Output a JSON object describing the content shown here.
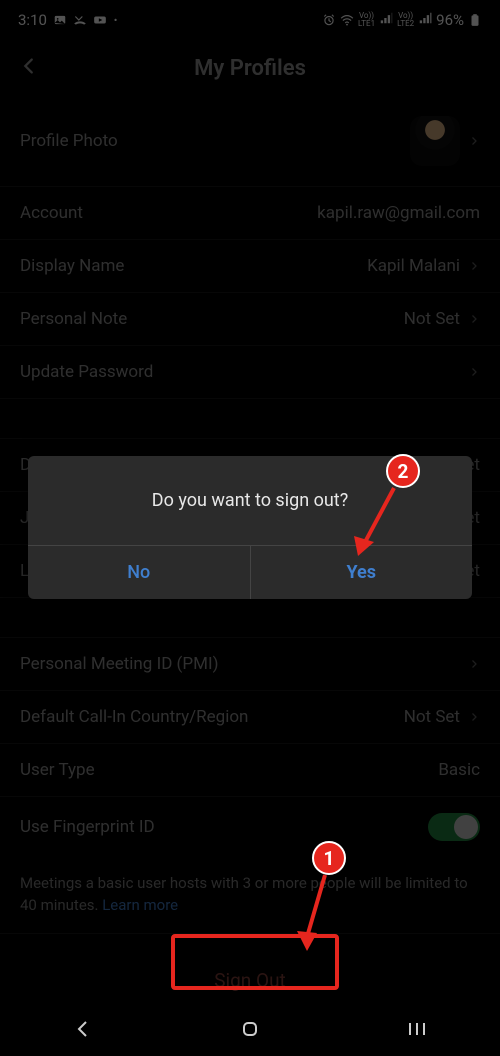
{
  "status": {
    "time": "3:10",
    "battery": "96%",
    "lte1": "LTE1",
    "lte2": "LTE2",
    "vo1": "Vo))",
    "vo2": "Vo))"
  },
  "header": {
    "title": "My Profiles"
  },
  "rows": {
    "profile_photo": "Profile Photo",
    "account_label": "Account",
    "account_value": "kapil.raw@gmail.com",
    "display_label": "Display Name",
    "display_value": "Kapil Malani",
    "note_label": "Personal Note",
    "note_value": "Not Set",
    "pwd_label": "Update Password",
    "dept_label": "Depa",
    "dept_value": "et",
    "job_label": "Job ...",
    "job_value": "et",
    "loc_label": "Loca",
    "loc_value": "et",
    "pmi_label": "Personal Meeting ID (PMI)",
    "callin_label": "Default Call-In Country/Region",
    "callin_value": "Not Set",
    "usertype_label": "User Type",
    "usertype_value": "Basic",
    "finger_label": "Use Fingerprint ID"
  },
  "note_text": "Meetings a basic user hosts with 3 or more people will be limited to 40 minutes. ",
  "learn_more": "Learn more",
  "signout": "Sign Out",
  "dialog": {
    "message": "Do you want to sign out?",
    "no": "No",
    "yes": "Yes"
  },
  "annot": {
    "one": "1",
    "two": "2"
  }
}
